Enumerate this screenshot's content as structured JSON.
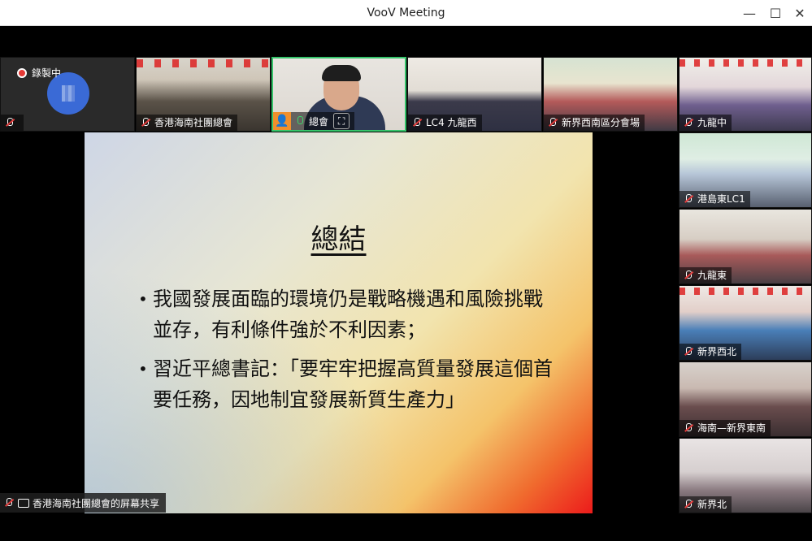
{
  "window": {
    "title": "VooV Meeting",
    "controls": {
      "minimize": "—",
      "maximize": "☐",
      "close": "✕"
    }
  },
  "recording": {
    "label": "錄製中"
  },
  "top_strip": [
    {
      "name": ""
    },
    {
      "name": "香港海南社團總會"
    },
    {
      "name": "總會"
    },
    {
      "name": "LC4 九龍西"
    },
    {
      "name": "新界西南區分會場"
    },
    {
      "name": "九龍中"
    }
  ],
  "side_strip": [
    {
      "name": "港島東LC1"
    },
    {
      "name": "九龍東"
    },
    {
      "name": "新界西北"
    },
    {
      "name": "海南—新界東南"
    },
    {
      "name": "新界北"
    }
  ],
  "slide": {
    "title": "總結",
    "bullets": [
      {
        "dot": "•",
        "text": "我國發展面臨的環境仍是戰略機遇和風險挑戰並存，有利條件強於不利因素；"
      },
      {
        "dot": "•",
        "text": "習近平總書記：「要牢牢把握高質量發展這個首要任務，因地制宜發展新質生產力」"
      }
    ]
  },
  "screen_share": {
    "label": "香港海南社團總會的屏幕共享"
  }
}
